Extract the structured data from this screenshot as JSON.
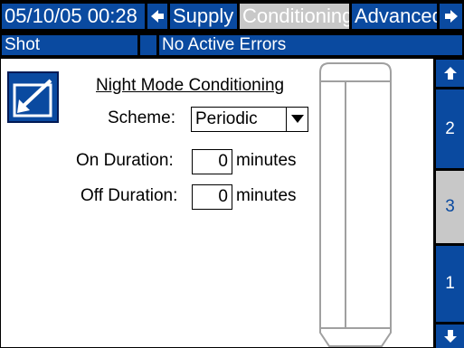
{
  "header": {
    "datetime": "05/10/05 00:28",
    "tabs": [
      {
        "label": "Supply",
        "active": false
      },
      {
        "label": "Conditioning",
        "active": true
      },
      {
        "label": "Advanced",
        "active": false
      }
    ],
    "left_arrow_icon": "arrow-left-icon",
    "right_arrow_icon": "arrow-right-icon"
  },
  "status": {
    "mode": "Shot",
    "indicator": "",
    "message": "No Active Errors"
  },
  "screen": {
    "icon": "edit-screen-icon",
    "title": "Night Mode Conditioning",
    "scheme_label": "Scheme:",
    "scheme_value": "Periodic",
    "on_label": "On Duration:",
    "on_value": "0",
    "off_label": "Off Duration:",
    "off_value": "0",
    "unit": "minutes"
  },
  "sidenav": {
    "up_icon": "arrow-up-icon",
    "down_icon": "arrow-down-icon",
    "pages": [
      {
        "label": "2",
        "active": false
      },
      {
        "label": "3",
        "active": true
      },
      {
        "label": "1",
        "active": false
      }
    ]
  },
  "colors": {
    "accent": "#0a4aa0",
    "tab_active": "#c8c8c8",
    "frame": "#000000"
  }
}
